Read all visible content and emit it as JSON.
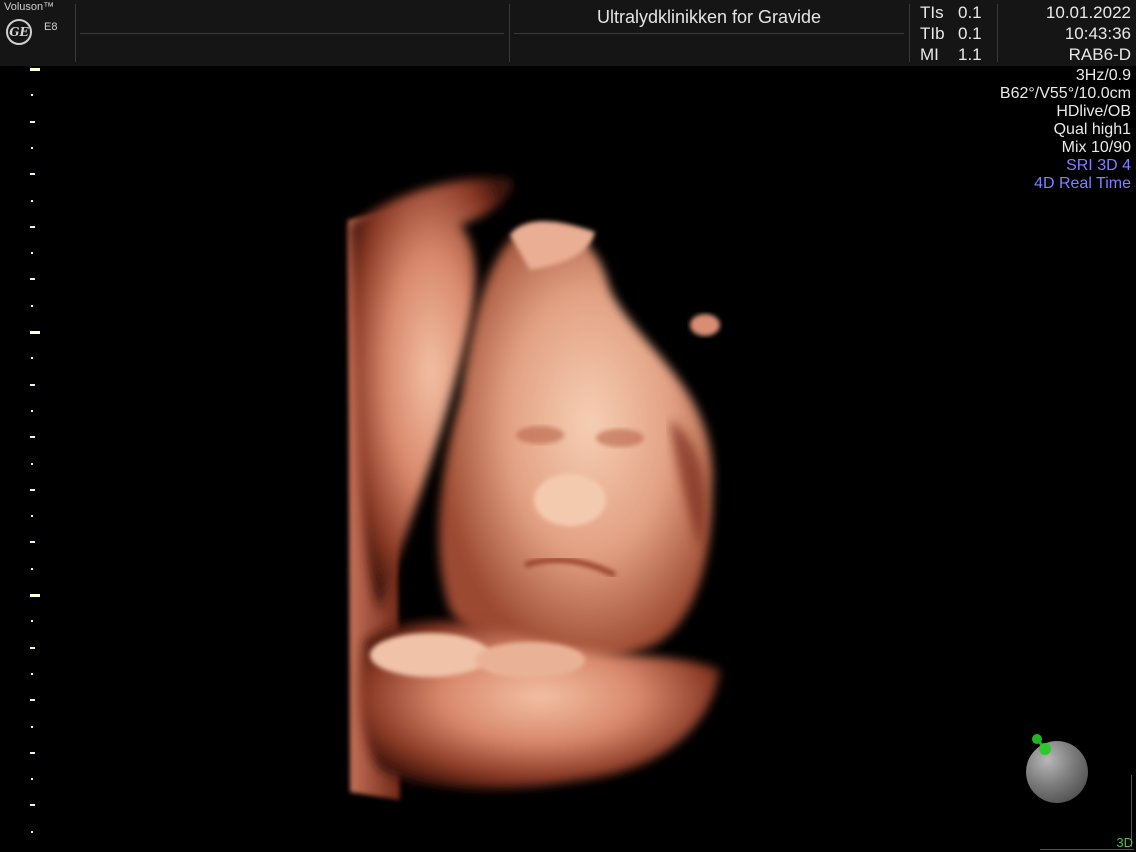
{
  "header": {
    "brand": "Voluson™",
    "logo_text": "GE",
    "model": "E8",
    "clinic": "Ultralydklinikken for Gravide",
    "params": [
      {
        "label": "TIs",
        "value": "0.1"
      },
      {
        "label": "TIb",
        "value": "0.1"
      },
      {
        "label": "MI",
        "value": "1.1"
      }
    ],
    "date": "10.01.2022",
    "time": "10:43:36",
    "probe": "RAB6-D"
  },
  "info": {
    "lines": [
      "3Hz/0.9",
      "B62°/V55°/10.0cm",
      "HDlive/OB",
      "Qual high1",
      "Mix 10/90"
    ],
    "accent_lines": [
      "SRI 3D 4",
      "4D Real Time"
    ],
    "accent_color": "#8080ff"
  },
  "render": {
    "icon": "fetal-3d-render",
    "skin_color": "#e0967c"
  },
  "orientation": {
    "icon": "orientation-ball-icon",
    "handle_color": "#22b422"
  },
  "mode": "3D"
}
